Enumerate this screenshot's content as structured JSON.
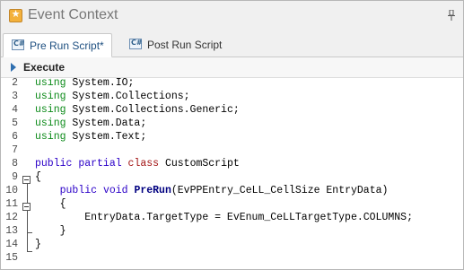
{
  "window": {
    "title": "Event Context",
    "title_icon": "star-icon",
    "pin_icon": "pin-icon"
  },
  "tabs": [
    {
      "label": "Pre Run Script*",
      "icon": "csharp-file-icon",
      "active": true
    },
    {
      "label": "Post Run Script",
      "icon": "csharp-file-icon",
      "active": false
    }
  ],
  "toolbar": {
    "execute_label": "Execute"
  },
  "editor": {
    "lines": [
      {
        "n": "2",
        "tokens": [
          {
            "t": "using",
            "c": "gr"
          },
          {
            "t": " System.IO;",
            "c": ""
          }
        ]
      },
      {
        "n": "3",
        "tokens": [
          {
            "t": "using",
            "c": "gr"
          },
          {
            "t": " System.Collections;",
            "c": ""
          }
        ]
      },
      {
        "n": "4",
        "tokens": [
          {
            "t": "using",
            "c": "gr"
          },
          {
            "t": " System.Collections.Generic;",
            "c": ""
          }
        ]
      },
      {
        "n": "5",
        "tokens": [
          {
            "t": "using",
            "c": "gr"
          },
          {
            "t": " System.Data;",
            "c": ""
          }
        ]
      },
      {
        "n": "6",
        "tokens": [
          {
            "t": "using",
            "c": "gr"
          },
          {
            "t": " System.Text;",
            "c": ""
          }
        ]
      },
      {
        "n": "7",
        "tokens": []
      },
      {
        "n": "8",
        "tokens": [
          {
            "t": "public",
            "c": "kw"
          },
          {
            "t": " ",
            "c": ""
          },
          {
            "t": "partial",
            "c": "kw"
          },
          {
            "t": " ",
            "c": ""
          },
          {
            "t": "class",
            "c": "ty"
          },
          {
            "t": " CustomScript",
            "c": ""
          }
        ]
      },
      {
        "n": "9",
        "tokens": [
          {
            "t": "{",
            "c": ""
          }
        ]
      },
      {
        "n": "10",
        "tokens": [
          {
            "t": "    ",
            "c": ""
          },
          {
            "t": "public",
            "c": "kw"
          },
          {
            "t": " ",
            "c": ""
          },
          {
            "t": "void",
            "c": "kw"
          },
          {
            "t": " ",
            "c": ""
          },
          {
            "t": "PreRun",
            "c": "fn"
          },
          {
            "t": "(EvPPEntry_CeLL_CellSize EntryData)",
            "c": ""
          }
        ]
      },
      {
        "n": "11",
        "tokens": [
          {
            "t": "    {",
            "c": ""
          }
        ]
      },
      {
        "n": "12",
        "tokens": [
          {
            "t": "        EntryData.TargetType = EvEnum_CeLLTargetType.COLUMNS;",
            "c": ""
          }
        ]
      },
      {
        "n": "13",
        "tokens": [
          {
            "t": "    }",
            "c": ""
          }
        ]
      },
      {
        "n": "14",
        "tokens": [
          {
            "t": "}",
            "c": ""
          }
        ]
      },
      {
        "n": "15",
        "tokens": []
      }
    ]
  }
}
